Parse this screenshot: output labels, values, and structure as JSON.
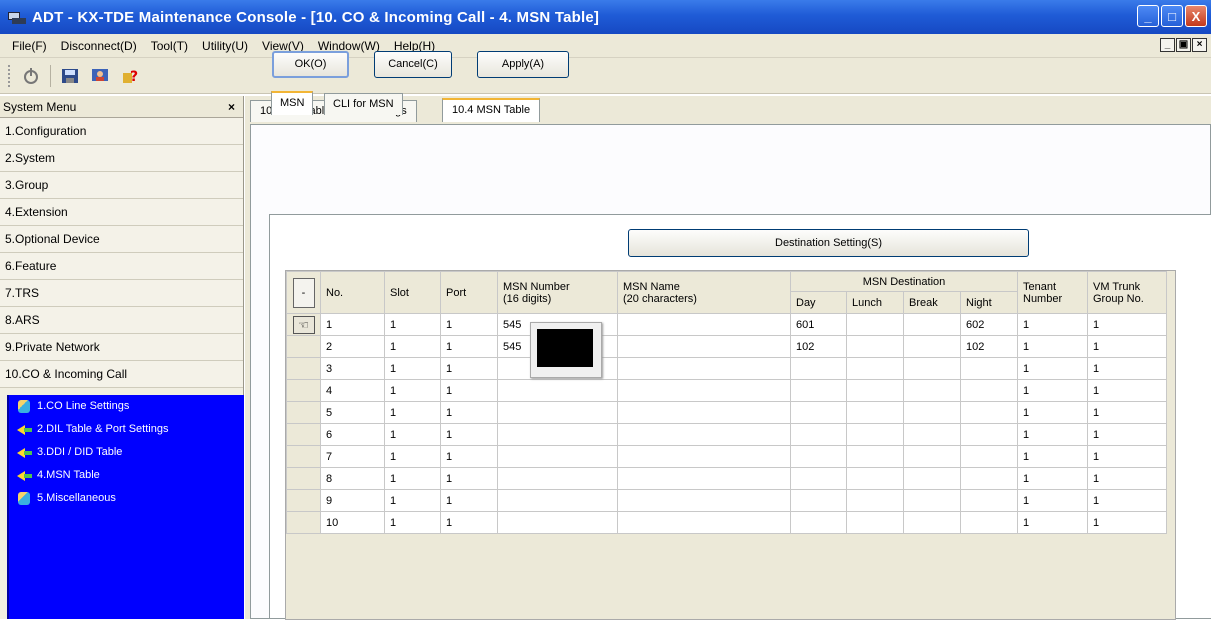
{
  "window": {
    "title": "ADT - KX-TDE Maintenance Console - [10. CO & Incoming Call - 4. MSN Table]",
    "minimize_glyph": "_",
    "maximize_glyph": "□",
    "close_glyph": "X"
  },
  "menu": [
    "File(F)",
    "Disconnect(D)",
    "Tool(T)",
    "Utility(U)",
    "View(V)",
    "Window(W)",
    "Help(H)"
  ],
  "toolbar": {
    "icons": [
      "connect-icon",
      "save-icon",
      "users-icon",
      "help-icon"
    ]
  },
  "sidebar": {
    "header": "System Menu",
    "close_glyph": "×",
    "items": [
      "1.Configuration",
      "2.System",
      "3.Group",
      "4.Extension",
      "5.Optional Device",
      "6.Feature",
      "7.TRS",
      "8.ARS",
      "9.Private Network",
      "10.CO & Incoming Call"
    ],
    "sub_items": [
      "1.CO Line Settings",
      "2.DIL Table & Port Settings",
      "3.DDI / DID Table",
      "4.MSN Table",
      "5.Miscellaneous"
    ]
  },
  "tabs": [
    "10.2 DIL Table & Port Settings",
    "10.4 MSN Table"
  ],
  "buttons": {
    "ok": "OK(O)",
    "cancel": "Cancel(C)",
    "apply": "Apply(A)",
    "destination": "Destination Setting(S)"
  },
  "inner_tabs": [
    "MSN",
    "CLI for MSN"
  ],
  "table": {
    "select_header": "-",
    "headers": {
      "no": "No.",
      "slot": "Slot",
      "port": "Port",
      "msn_number": "MSN Number",
      "msn_number_sub": "(16 digits)",
      "msn_name": "MSN Name",
      "msn_name_sub": "(20 characters)",
      "dest_group": "MSN Destination",
      "day": "Day",
      "lunch": "Lunch",
      "break": "Break",
      "night": "Night",
      "tenant": "Tenant",
      "tenant_sub": "Number",
      "vm": "VM Trunk",
      "vm_sub": "Group No."
    },
    "rows": [
      {
        "no": "1",
        "slot": "1",
        "port": "1",
        "msn": "545",
        "name": "",
        "day": "601",
        "lunch": "",
        "brk": "",
        "night": "602",
        "tenant": "1",
        "vm": "1"
      },
      {
        "no": "2",
        "slot": "1",
        "port": "1",
        "msn": "545",
        "name": "",
        "day": "102",
        "lunch": "",
        "brk": "",
        "night": "102",
        "tenant": "1",
        "vm": "1"
      },
      {
        "no": "3",
        "slot": "1",
        "port": "1",
        "msn": "",
        "name": "",
        "day": "",
        "lunch": "",
        "brk": "",
        "night": "",
        "tenant": "1",
        "vm": "1"
      },
      {
        "no": "4",
        "slot": "1",
        "port": "1",
        "msn": "",
        "name": "",
        "day": "",
        "lunch": "",
        "brk": "",
        "night": "",
        "tenant": "1",
        "vm": "1"
      },
      {
        "no": "5",
        "slot": "1",
        "port": "1",
        "msn": "",
        "name": "",
        "day": "",
        "lunch": "",
        "brk": "",
        "night": "",
        "tenant": "1",
        "vm": "1"
      },
      {
        "no": "6",
        "slot": "1",
        "port": "1",
        "msn": "",
        "name": "",
        "day": "",
        "lunch": "",
        "brk": "",
        "night": "",
        "tenant": "1",
        "vm": "1"
      },
      {
        "no": "7",
        "slot": "1",
        "port": "1",
        "msn": "",
        "name": "",
        "day": "",
        "lunch": "",
        "brk": "",
        "night": "",
        "tenant": "1",
        "vm": "1"
      },
      {
        "no": "8",
        "slot": "1",
        "port": "1",
        "msn": "",
        "name": "",
        "day": "",
        "lunch": "",
        "brk": "",
        "night": "",
        "tenant": "1",
        "vm": "1"
      },
      {
        "no": "9",
        "slot": "1",
        "port": "1",
        "msn": "",
        "name": "",
        "day": "",
        "lunch": "",
        "brk": "",
        "night": "",
        "tenant": "1",
        "vm": "1"
      },
      {
        "no": "10",
        "slot": "1",
        "port": "1",
        "msn": "",
        "name": "",
        "day": "",
        "lunch": "",
        "brk": "",
        "night": "",
        "tenant": "1",
        "vm": "1"
      }
    ]
  }
}
